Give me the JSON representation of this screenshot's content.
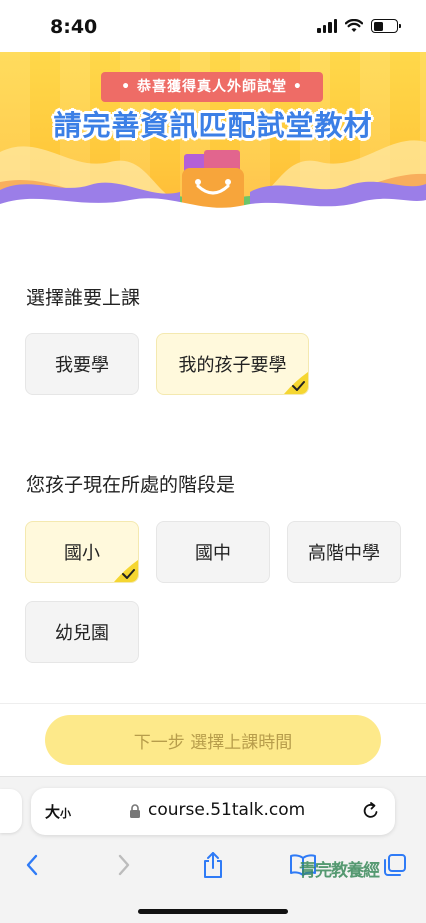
{
  "status_bar": {
    "time": "8:40"
  },
  "banner": {
    "ribbon_text": "• 恭喜獲得真人外師試堂 •",
    "title": "請完善資訊匹配試堂教材"
  },
  "section1": {
    "label": "選擇誰要上課",
    "options": [
      {
        "label": "我要學",
        "selected": false
      },
      {
        "label": "我的孩子要學",
        "selected": true
      }
    ]
  },
  "section2": {
    "label": "您孩子現在所處的階段是",
    "options": [
      {
        "label": "國小",
        "selected": true
      },
      {
        "label": "國中",
        "selected": false
      },
      {
        "label": "高階中學",
        "selected": false
      },
      {
        "label": "幼兒園",
        "selected": false
      }
    ]
  },
  "next_button": {
    "label": "下一步 選擇上課時間"
  },
  "browser": {
    "text_size_label": "大",
    "text_size_small": "小",
    "url": "course.51talk.com",
    "watermark": "青完教養經"
  },
  "colors": {
    "accent_yellow": "#fde98a",
    "selected_bg": "#fff9dc",
    "check_yellow": "#f5d631",
    "title_blue": "#3b7fe6",
    "ribbon_red": "#ee6c66"
  },
  "icons": [
    "signal-icon",
    "wifi-icon",
    "battery-icon",
    "lock-icon",
    "reload-icon",
    "back-icon",
    "forward-icon",
    "share-icon",
    "bookmarks-icon",
    "tabs-icon",
    "checkmark-icon"
  ]
}
